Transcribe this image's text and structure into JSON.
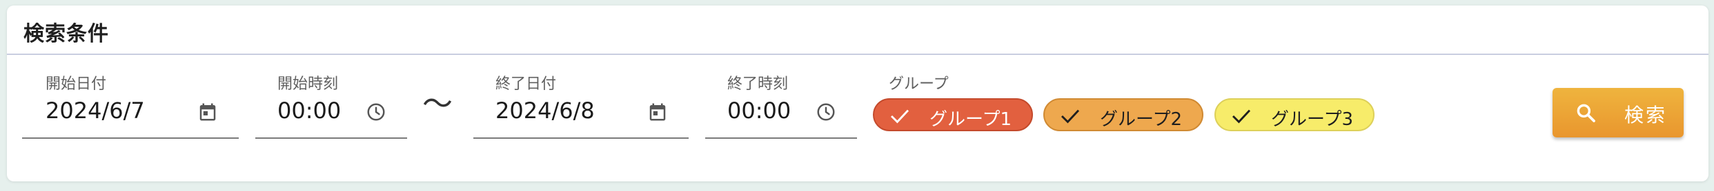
{
  "panel": {
    "title": "検索条件"
  },
  "start_date": {
    "label": "開始日付",
    "value": "2024/6/7",
    "icon": "calendar-icon"
  },
  "start_time": {
    "label": "開始時刻",
    "value": "00:00",
    "icon": "clock-icon"
  },
  "range_separator": "〜",
  "end_date": {
    "label": "終了日付",
    "value": "2024/6/8",
    "icon": "calendar-icon"
  },
  "end_time": {
    "label": "終了時刻",
    "value": "00:00",
    "icon": "clock-icon"
  },
  "group": {
    "label": "グループ",
    "chips": [
      {
        "label": "グループ1",
        "checked": true,
        "color": "#e2603f",
        "border": "#c44a2c"
      },
      {
        "label": "グループ2",
        "checked": true,
        "color": "#eea84e",
        "border": "#d08a33"
      },
      {
        "label": "グループ3",
        "checked": true,
        "color": "#f7ec6a",
        "border": "#ddd05a"
      }
    ]
  },
  "search_button": {
    "label": "検索",
    "icon": "search-icon",
    "color": "#eba23a"
  }
}
